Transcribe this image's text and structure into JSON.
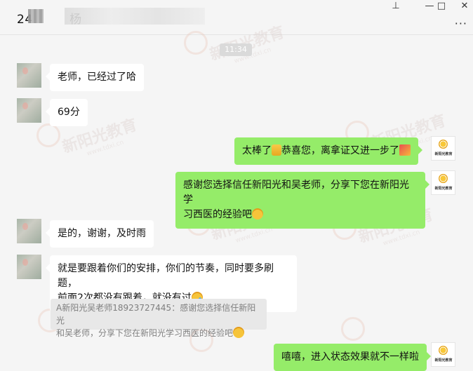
{
  "window": {
    "title": "24　　　杨",
    "controls": {
      "pin": "⊥",
      "minimize": "—",
      "maximize": "□",
      "close": "✕",
      "more": "···"
    }
  },
  "watermark": {
    "text": "新阳光教育",
    "url": "www.tdxi.cn"
  },
  "chat": {
    "timestamp": "11:34",
    "messages": [
      {
        "side": "left",
        "text": "老师，已经过了哈"
      },
      {
        "side": "left",
        "text": "69分"
      },
      {
        "side": "right",
        "text_parts": [
          "太棒了",
          "恭喜您，离拿证又进一步了"
        ],
        "emojis": [
          "thumbs-up",
          "party-popper"
        ]
      },
      {
        "side": "right",
        "line1": "感谢您选择信任新阳光和吴老师，分享下您在新阳光学",
        "line2": "习西医的经验吧",
        "emoji": "smile"
      },
      {
        "side": "left",
        "text": "是的，谢谢，及时雨"
      },
      {
        "side": "left",
        "line1": "就是要跟着你们的安排，你们的节奏，同时要多刷题，",
        "line2": "前面2次都没有跟着，就没有过",
        "emoji": "sweat"
      },
      {
        "side": "right",
        "text": "嘻嘻，进入状态效果就不一样啦"
      }
    ],
    "quote": {
      "line1": "A新阳光吴老师18923727445：感谢您选择信任新阳光",
      "line2": "和吴老师，分享下您在新阳光学习西医的经验吧",
      "emoji": "smile"
    }
  },
  "colors": {
    "bubble_sent": "#95ec69",
    "bubble_received": "#ffffff",
    "background": "#f5f5f5"
  }
}
